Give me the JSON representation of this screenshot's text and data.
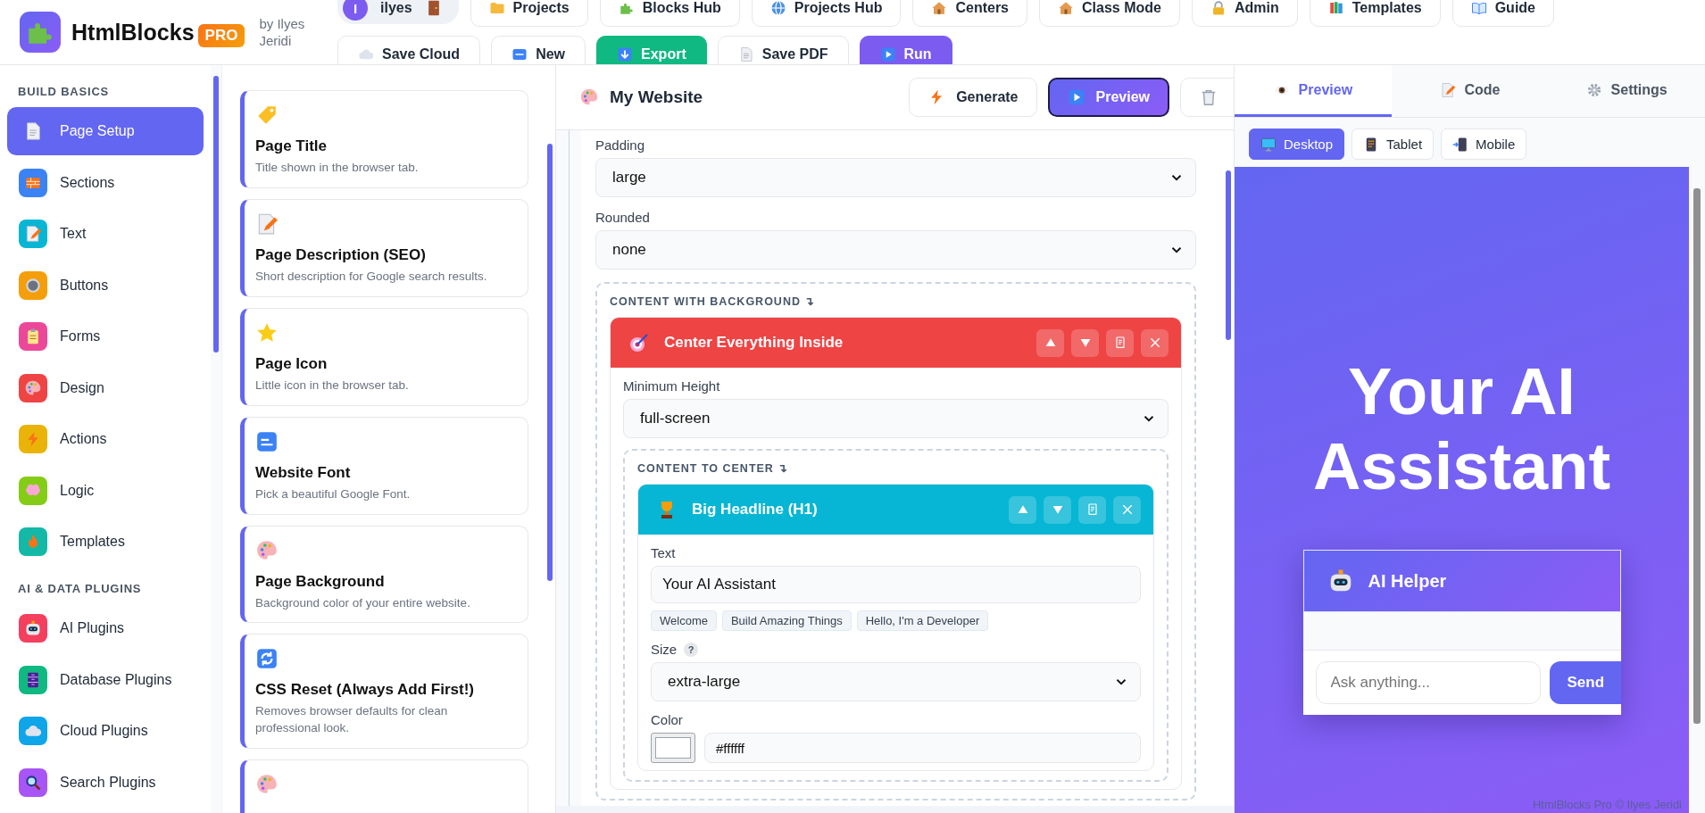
{
  "header": {
    "logo": {
      "name": "HtmlBlocks",
      "badge": "PRO"
    },
    "byline": "by Ilyes Jeridi",
    "user": {
      "initial": "I",
      "name": "ilyes"
    },
    "nav_buttons": [
      {
        "label": "Projects"
      },
      {
        "label": "Blocks Hub"
      },
      {
        "label": "Projects Hub"
      },
      {
        "label": "Centers"
      },
      {
        "label": "Class Mode"
      },
      {
        "label": "Admin"
      },
      {
        "label": "Templates"
      },
      {
        "label": "Guide"
      }
    ],
    "action_buttons": [
      {
        "label": "Save Cloud",
        "kind": "plain"
      },
      {
        "label": "New",
        "kind": "plain"
      },
      {
        "label": "Export",
        "kind": "export"
      },
      {
        "label": "Save PDF",
        "kind": "plain"
      },
      {
        "label": "Run",
        "kind": "run"
      }
    ]
  },
  "sidebar": {
    "sections": [
      {
        "heading": "BUILD BASICS",
        "items": [
          {
            "label": "Page Setup",
            "selected": true
          },
          {
            "label": "Sections",
            "selected": false,
            "color": "#3b82f6"
          },
          {
            "label": "Text",
            "selected": false,
            "color": "#06b6d4"
          },
          {
            "label": "Buttons",
            "selected": false,
            "color": "#f59e0b"
          },
          {
            "label": "Forms",
            "selected": false,
            "color": "#ec4899"
          },
          {
            "label": "Design",
            "selected": false,
            "color": "#ef4444"
          },
          {
            "label": "Actions",
            "selected": false,
            "color": "#eab308"
          },
          {
            "label": "Logic",
            "selected": false,
            "color": "#84cc16"
          },
          {
            "label": "Templates",
            "selected": false,
            "color": "#14b8a6"
          }
        ]
      },
      {
        "heading": "AI & DATA PLUGINS",
        "items": [
          {
            "label": "AI Plugins",
            "selected": false,
            "color": "#f43f5e"
          },
          {
            "label": "Database Plugins",
            "selected": false,
            "color": "#10b981"
          },
          {
            "label": "Cloud Plugins",
            "selected": false,
            "color": "#0ea5e9"
          },
          {
            "label": "Search Plugins",
            "selected": false,
            "color": "#a855f7"
          }
        ]
      }
    ]
  },
  "blocks": [
    {
      "kind": "block",
      "title": "Page Title",
      "description": "Title shown in the browser tab."
    },
    {
      "kind": "block",
      "title": "Page Description (SEO)",
      "description": "Short description for Google search results."
    },
    {
      "kind": "block",
      "title": "Page Icon",
      "description": "Little icon in the browser tab."
    },
    {
      "kind": "block",
      "title": "Website Font",
      "description": "Pick a beautiful Google Font."
    },
    {
      "kind": "block",
      "title": "Page Background",
      "description": "Background color of your entire website."
    },
    {
      "kind": "block",
      "title": "CSS Reset (Always Add First!)",
      "description": "Removes browser defaults for clean professional look."
    },
    {
      "kind": "cut"
    }
  ],
  "editor": {
    "title": "My Website",
    "buttons": [
      {
        "label": "Generate",
        "selected": false
      },
      {
        "label": "Preview",
        "selected": true
      }
    ],
    "fields": [
      {
        "label": "Padding",
        "value": "large"
      },
      {
        "label": "Rounded",
        "value": "none"
      }
    ],
    "section": {
      "label": "CONTENT WITH BACKGROUND ↴",
      "block": {
        "title": "Center Everything Inside",
        "color": "#ef4444",
        "fields": [
          {
            "label": "Minimum Height",
            "value": "full-screen"
          }
        ],
        "section": {
          "label": "CONTENT TO CENTER ↴",
          "block": {
            "title": "Big Headline (H1)",
            "color": "#06b6d4",
            "text_field": {
              "label": "Text",
              "value": "Your AI Assistant",
              "suggestions": [
                "Welcome",
                "Build Amazing Things",
                "Hello, I'm a Developer"
              ]
            },
            "size_field": {
              "label": "Size",
              "help": "?",
              "value": "extra-large"
            },
            "color_field": {
              "label": "Color",
              "value": "#ffffff"
            }
          }
        }
      }
    }
  },
  "preview": {
    "tabs": [
      {
        "label": "Preview",
        "selected": true
      },
      {
        "label": "Code",
        "selected": false
      },
      {
        "label": "Settings",
        "selected": false
      }
    ],
    "devices": [
      {
        "label": "Desktop",
        "selected": true
      },
      {
        "label": "Tablet",
        "selected": false
      },
      {
        "label": "Mobile",
        "selected": false
      }
    ],
    "page": {
      "headline": "Your AI Assistant",
      "widget": {
        "title": "AI Helper",
        "placeholder": "Ask anything...",
        "button": "Send"
      },
      "footer": "HtmlBlocks Pro © Ilyes Jeridi"
    }
  }
}
